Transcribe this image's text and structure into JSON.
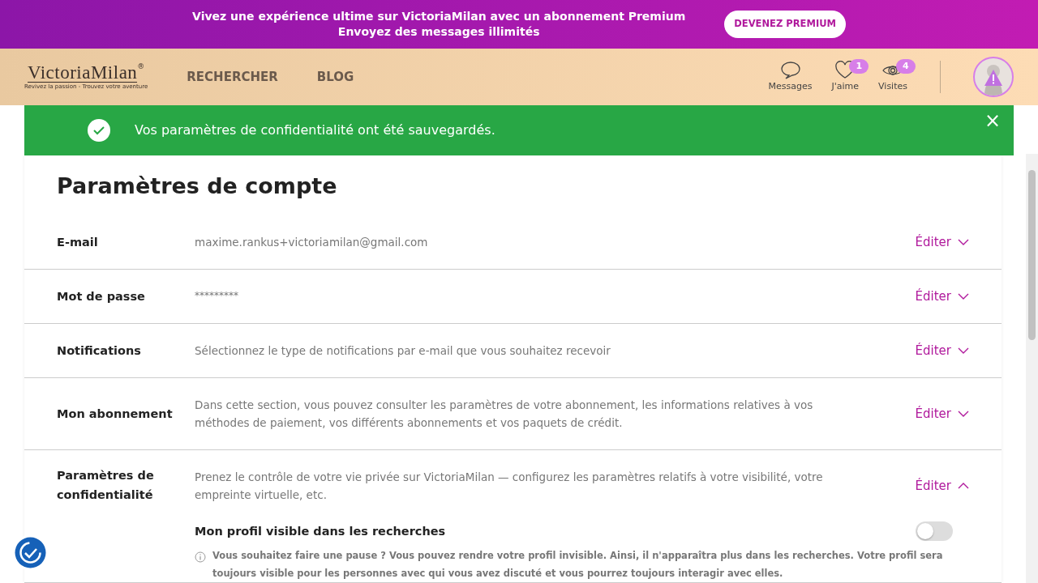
{
  "promo_banner": {
    "lines": [
      "Vivez une expérience ultime sur VictoriaMilan avec un abonnement Premium",
      "Envoyez des messages illimités"
    ],
    "button": "DEVENEZ PREMIUM"
  },
  "header": {
    "logo": {
      "name": "VictoriaMilan",
      "registered": "®",
      "tagline": "Revivez la passion - Trouvez votre aventure"
    },
    "nav": [
      "RECHERCHER",
      "BLOG"
    ],
    "icons": [
      {
        "kind": "messages",
        "label": "Messages"
      },
      {
        "kind": "likes",
        "label": "J'aime",
        "count": "1"
      },
      {
        "kind": "visits",
        "label": "Visites",
        "count": "4"
      }
    ]
  },
  "alert": {
    "message": "Vos paramètres de confidentialité ont été sauvegardés.",
    "close": "×"
  },
  "title": "Paramètres de compte",
  "settings": [
    {
      "label": "E-mail",
      "value": "maxime.rankus+victoriamilan@gmail.com",
      "kind": "value",
      "action": "Éditer",
      "expanded": false
    },
    {
      "label": "Mot de passe",
      "value": "*********",
      "kind": "masked",
      "action": "Éditer",
      "expanded": false
    },
    {
      "label": "Notifications",
      "value": "Sélectionnez le type de notifications par e-mail que vous souhaitez recevoir",
      "kind": "description",
      "action": "Éditer",
      "expanded": false
    },
    {
      "label": "Mon abonnement",
      "value": "Dans cette section, vous pouvez consulter les paramètres de votre abonnement, les informations relatives à vos méthodes de paiement, vos différents abonnements et vos paquets de crédit.",
      "kind": "description",
      "action": "Éditer",
      "expanded": false
    },
    {
      "label": "Paramètres de confidentialité",
      "value": "Prenez le contrôle de votre vie privée sur VictoriaMilan — configurez les paramètres relatifs à votre visibilité, votre empreinte virtuelle, etc.",
      "kind": "description",
      "action": "Éditer",
      "expanded": true,
      "options": [
        {
          "label": "Mon profil visible dans les recherches",
          "on": false,
          "info": "Vous souhaitez faire une pause ? Vous pouvez rendre votre profil invisible. Ainsi, il n'apparaîtra plus dans les recherches. Votre profil sera toujours visible pour les personnes avec qui vous avez discuté et vous pourrez toujours interagir avec elles."
        }
      ]
    }
  ]
}
